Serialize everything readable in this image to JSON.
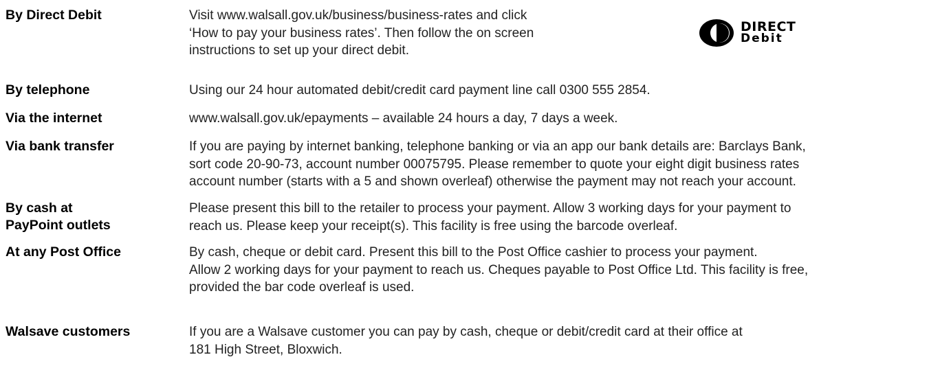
{
  "logo": {
    "line1": "DIRECT",
    "line2": "Debit"
  },
  "rows": [
    {
      "method": "By Direct Debit",
      "description": "Visit www.walsall.gov.uk/business/business-rates and click\n‘How to pay your business rates’. Then follow the on screen\ninstructions to set up your direct debit."
    },
    {
      "method": "By telephone",
      "description": "Using our 24 hour automated debit/credit card payment line call 0300 555 2854."
    },
    {
      "method": "Via the internet",
      "description": "www.walsall.gov.uk/epayments – available 24 hours a day, 7 days a week."
    },
    {
      "method": "Via bank transfer",
      "description": "If you are paying by internet banking, telephone banking or via an app our bank details are: Barclays Bank,\nsort code 20-90-73, account number 00075795. Please remember to quote your eight digit business rates\naccount number (starts with a 5 and shown overleaf) otherwise the payment may not reach your account."
    },
    {
      "method": "By cash at\nPayPoint outlets",
      "description": "Please present this bill to the retailer to process your payment. Allow 3 working days for your payment to\nreach us. Please keep your receipt(s). This facility is free using the barcode overleaf."
    },
    {
      "method": "At any Post Office",
      "description": "By cash, cheque or debit card. Present this bill to the Post Office cashier to process your payment.\nAllow 2 working days for your payment to reach us. Cheques payable to Post Office Ltd. This facility is free,\nprovided the bar code overleaf is used."
    },
    {
      "method": "Walsave customers",
      "description": "If you are a Walsave customer you can pay by cash, cheque or debit/credit card at their office at\n181 High Street, Bloxwich."
    }
  ]
}
